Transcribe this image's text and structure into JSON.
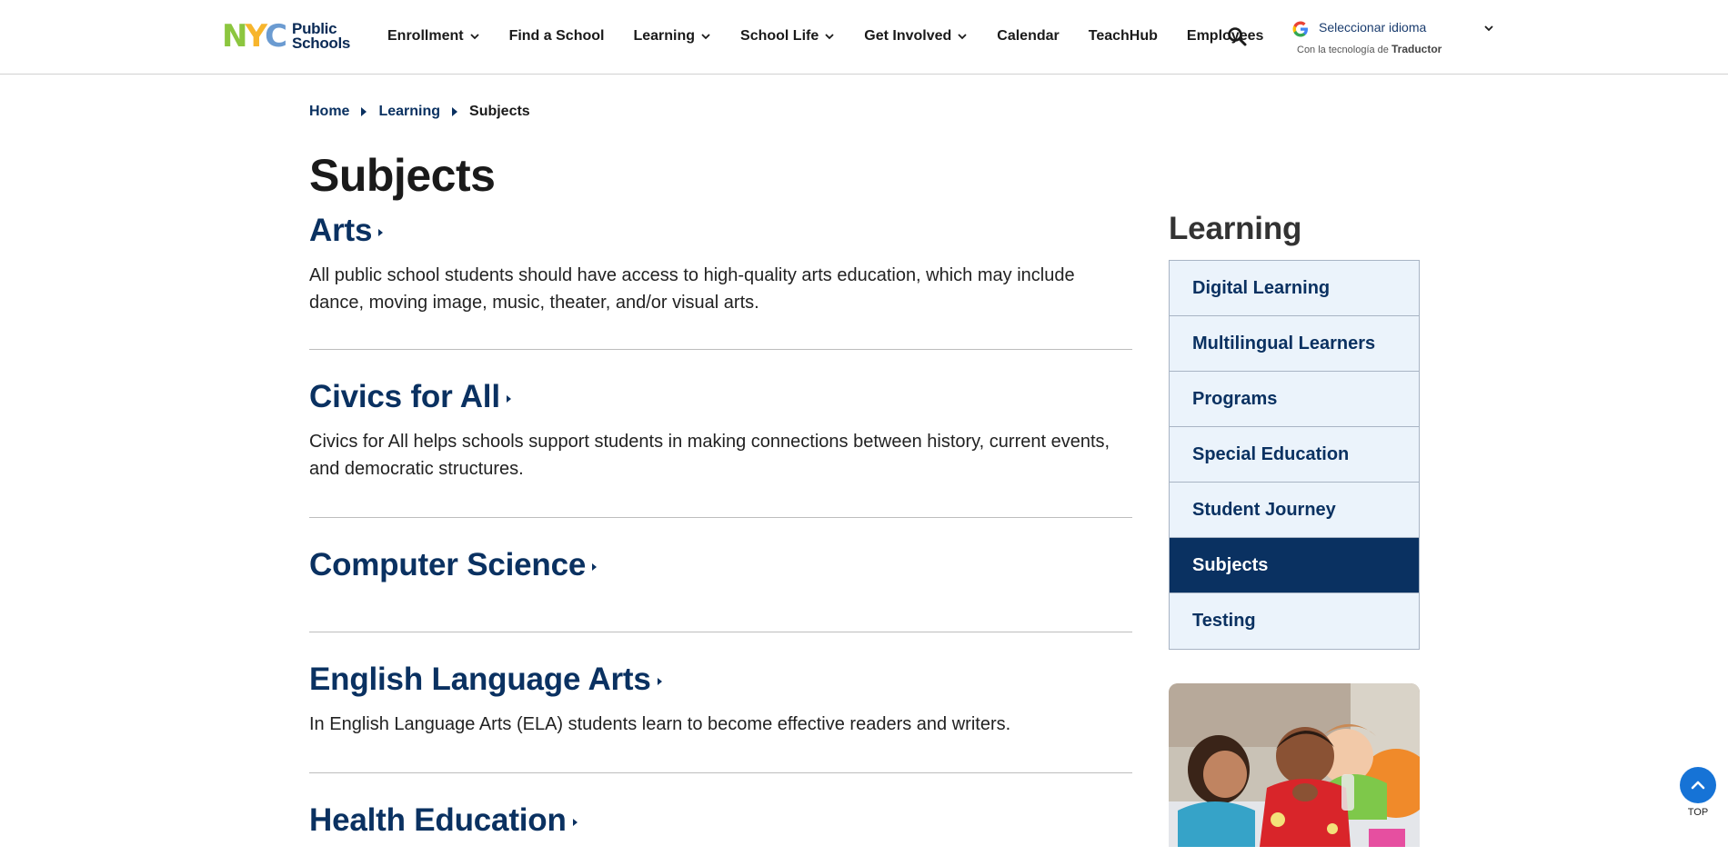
{
  "header": {
    "logo": {
      "nyc": "NYC",
      "line1": "Public",
      "line2": "Schools"
    },
    "nav": [
      {
        "label": "Enrollment",
        "has_dropdown": true
      },
      {
        "label": "Find a School",
        "has_dropdown": false
      },
      {
        "label": "Learning",
        "has_dropdown": true
      },
      {
        "label": "School Life",
        "has_dropdown": true
      },
      {
        "label": "Get Involved",
        "has_dropdown": true
      },
      {
        "label": "Calendar",
        "has_dropdown": false
      },
      {
        "label": "TeachHub",
        "has_dropdown": false
      },
      {
        "label": "Employees",
        "has_dropdown": false
      }
    ],
    "search_icon": "search-icon",
    "translate": {
      "label": "Seleccionar idioma",
      "powered_prefix": "Con la tecnología de",
      "powered_brand": "Traductor"
    }
  },
  "breadcrumb": [
    {
      "label": "Home",
      "link": true
    },
    {
      "label": "Learning",
      "link": true
    },
    {
      "label": "Subjects",
      "link": false
    }
  ],
  "page_title": "Subjects",
  "subjects": [
    {
      "title": "Arts",
      "description": "All public school students should have access to high-quality arts education, which may include dance, moving image, music, theater, and/or visual arts."
    },
    {
      "title": "Civics for All",
      "description": "Civics for All helps schools support students in making connections between history, current events, and democratic structures."
    },
    {
      "title": "Computer Science",
      "description": ""
    },
    {
      "title": "English Language Arts",
      "description": "In English Language Arts (ELA) students learn to become effective readers and writers."
    },
    {
      "title": "Health Education",
      "description": ""
    }
  ],
  "sidebar": {
    "title": "Learning",
    "items": [
      {
        "label": "Digital Learning",
        "active": false
      },
      {
        "label": "Multilingual Learners",
        "active": false
      },
      {
        "label": "Programs",
        "active": false
      },
      {
        "label": "Special Education",
        "active": false
      },
      {
        "label": "Student Journey",
        "active": false
      },
      {
        "label": "Subjects",
        "active": true
      },
      {
        "label": "Testing",
        "active": false
      }
    ]
  },
  "back_to_top": {
    "label": "TOP"
  },
  "colors": {
    "brand_navy": "#0a3161",
    "sidebar_bg": "#ebf3fb",
    "top_button": "#1673d6",
    "logo_green": "#8cc63f",
    "logo_yellow": "#f7b52c",
    "logo_blue": "#6b9bd1"
  }
}
